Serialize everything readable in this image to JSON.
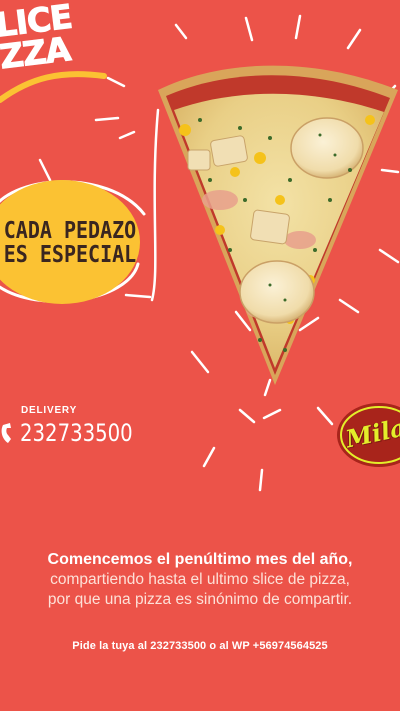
{
  "headline": {
    "line1": "LICE",
    "line2": "ZZA"
  },
  "badge": {
    "line1": "CADA PEDAZO",
    "line2": "ES ESPECIAL"
  },
  "delivery": {
    "label": "DELIVERY",
    "phone": "232733500"
  },
  "brand": {
    "logo_text": "Milano"
  },
  "copy": {
    "lead": "Comencemos el penúltimo mes del año,",
    "line2": "compartiendo hasta el ultimo slice de pizza,",
    "line3": "por que una pizza es sinónimo de compartir."
  },
  "cta": {
    "text": "Pide la tuya al 232733500 o al WP +56974564525"
  },
  "colors": {
    "background": "#ec5349",
    "badge": "#fbc233",
    "text": "#ffffff",
    "logo": "#e4ee2a"
  },
  "icons": {
    "phone": "phone-icon",
    "logo": "milano-logo"
  }
}
